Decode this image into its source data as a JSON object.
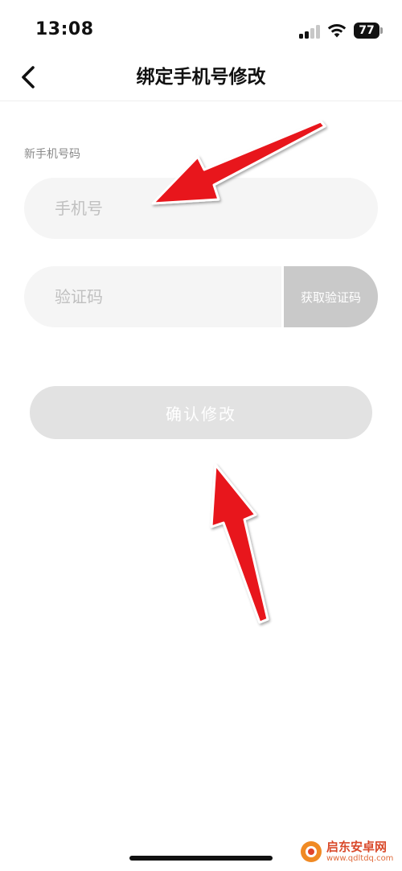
{
  "status_bar": {
    "time": "13:08",
    "battery": "77"
  },
  "nav": {
    "title": "绑定手机号修改"
  },
  "form": {
    "label": "新手机号码",
    "phone_placeholder": "手机号",
    "code_placeholder": "验证码",
    "get_code_label": "获取验证码",
    "confirm_label": "确认修改"
  },
  "watermark": {
    "brand": "启东安卓网",
    "url": "www.qdltdq.com"
  },
  "colors": {
    "arrow": "#e8141a",
    "field_bg": "#f5f5f5",
    "button_disabled": "#e2e2e2",
    "code_button": "#c9c9c9"
  },
  "icons": [
    "back-chevron-icon",
    "signal-icon",
    "wifi-icon",
    "battery-icon",
    "arrow-annotation-icon"
  ]
}
